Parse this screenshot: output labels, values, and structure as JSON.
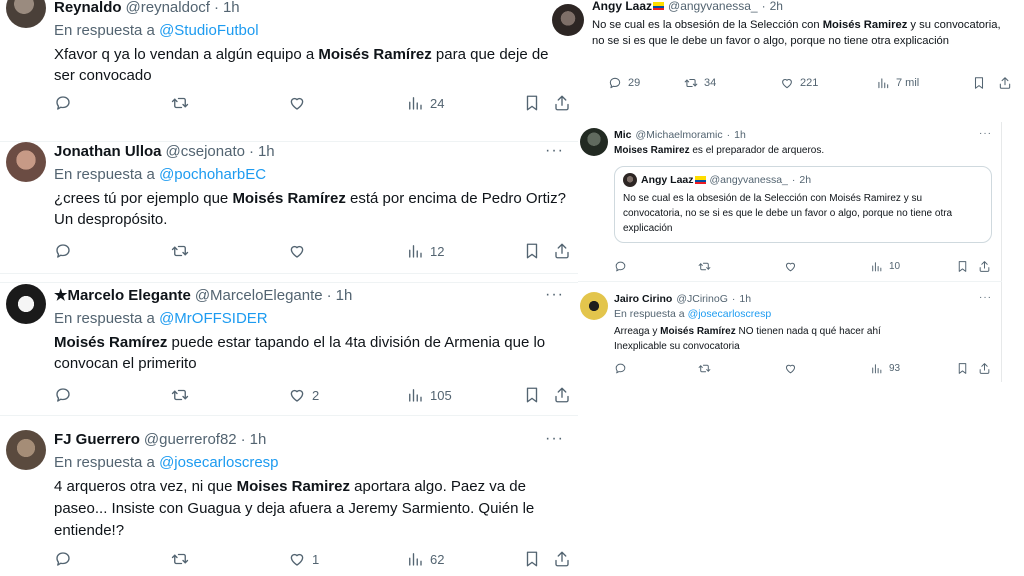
{
  "left_tweets": [
    {
      "name": "Reynaldo",
      "handle": "@reynaldocf",
      "dot": "·",
      "time": "1h",
      "reply_prefix": "En respuesta a",
      "reply_to": "@StudioFutbol",
      "body_parts": [
        "Xfavor q ya lo vendan a algún equipo a ",
        "Moisés Ramírez",
        " para que deje de ser convocado"
      ],
      "likes": "",
      "views": "24"
    },
    {
      "name": "Jonathan Ulloa",
      "handle": "@csejonato",
      "dot": "·",
      "time": "1h",
      "reply_prefix": "En respuesta a",
      "reply_to": "@pochoharbEC",
      "body_parts": [
        "¿crees tú por ejemplo que ",
        "Moisés Ramírez",
        " está por encima de Pedro Ortiz? Un despropósito."
      ],
      "likes": "",
      "views": "12"
    },
    {
      "name": "★Marcelo Elegante",
      "handle": "@MarceloElegante",
      "dot": "·",
      "time": "1h",
      "reply_prefix": "En respuesta a",
      "reply_to": "@MrOFFSIDER",
      "body_parts": [
        "",
        "Moisés Ramírez",
        " puede estar tapando el la 4ta división de Armenia que lo convocan el primerito"
      ],
      "likes": "2",
      "views": "105"
    },
    {
      "name": "FJ Guerrero",
      "handle": "@guerrerof82",
      "dot": "·",
      "time": "1h",
      "reply_prefix": "En respuesta a",
      "reply_to": "@josecarloscresp",
      "body_parts": [
        "4 arqueros otra vez, ni que ",
        "Moises Ramirez",
        " aportara algo. Paez va de paseo... Insiste con Guagua y deja afuera a Jeremy Sarmiento. Quién le entiende!?"
      ],
      "likes": "1",
      "views": "62"
    }
  ],
  "angy": {
    "name": "Angy Laaz",
    "handle": "@angyvanessa_",
    "dot": "·",
    "time": "2h",
    "body_parts": [
      "No se cual es la obsesión de la Selección con ",
      "Moisés Ramirez",
      " y su convocatoria, no se si es que le debe un favor o algo, porque no tiene otra explicación"
    ],
    "replies": "29",
    "retweets": "34",
    "likes": "221",
    "views": "7 mil"
  },
  "mic": {
    "name": "Mic",
    "handle": "@Michaelmoramic",
    "dot": "·",
    "time": "1h",
    "body_parts": [
      "",
      "Moises Ramirez",
      " es el preparador de arqueros."
    ],
    "views": "10",
    "quote": {
      "name": "Angy Laaz",
      "handle": "@angyvanessa_",
      "dot": "·",
      "time": "2h",
      "body": "No se cual es la obsesión de la Selección con Moisés Ramirez y su convocatoria, no se si es que le debe un favor o algo, porque no tiene otra explicación"
    }
  },
  "jairo": {
    "name": "Jairo Cirino",
    "handle": "@JCirinoG",
    "dot": "·",
    "time": "1h",
    "reply_prefix": "En respuesta a",
    "reply_to": "@josecarloscresp",
    "body_parts": [
      "Arreaga y ",
      "Moisés Ramírez",
      " NO tienen nada q qué hacer ahí"
    ],
    "body_line2": "Inexplicable su convocatoria",
    "views": "93"
  },
  "icons": {
    "reply": "reply-icon",
    "retweet": "retweet-icon",
    "like": "heart-icon",
    "views": "views-chart-icon",
    "bookmark": "bookmark-icon",
    "share": "share-icon",
    "more": "more-dots-icon"
  },
  "more_glyph": "···",
  "colors": {
    "link": "#1d9bf0",
    "muted": "#536471",
    "text": "#0f1419",
    "border": "#cfd9de"
  }
}
